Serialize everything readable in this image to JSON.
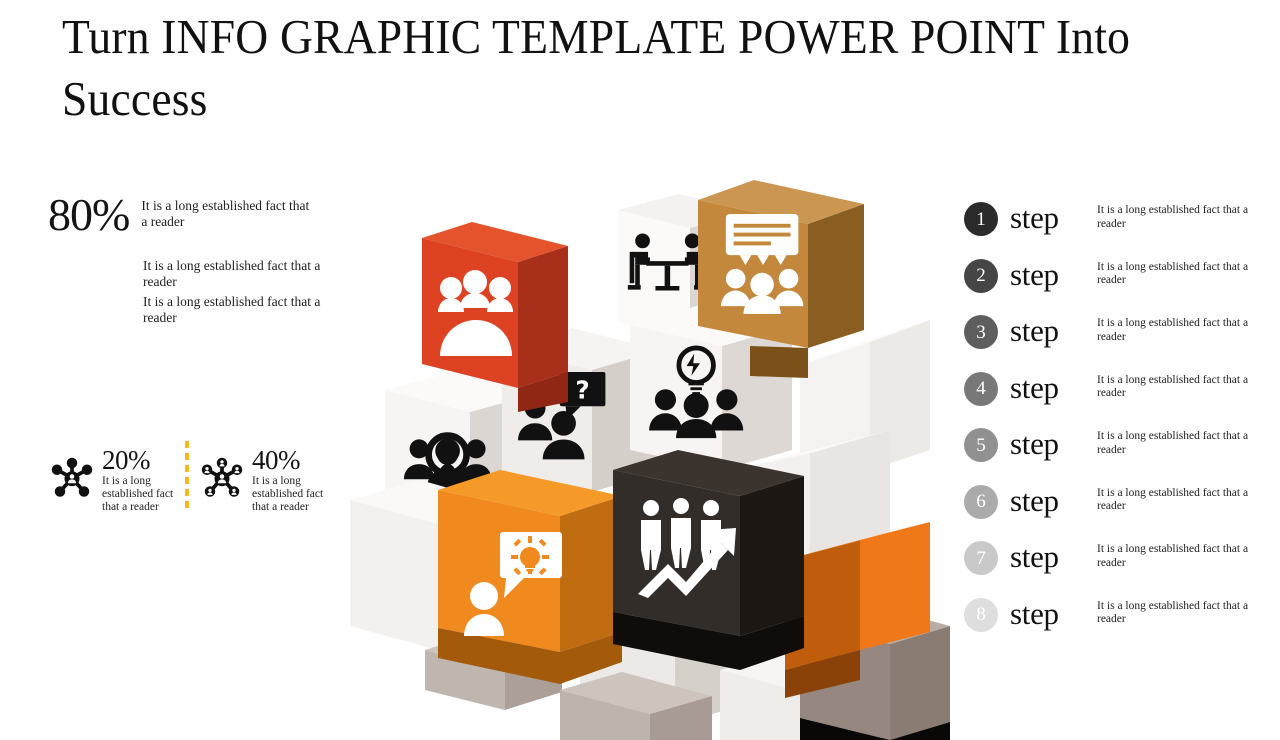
{
  "slide": {
    "title": "Turn INFO GRAPHIC TEMPLATE POWER POINT Into Success",
    "background_color": "#ffffff"
  },
  "left_panel": {
    "headline_stat": {
      "value": "80%",
      "description": "It is a long established fact that a reader"
    },
    "paragraphs": [
      "It is a long established fact that a reader",
      "It is a long established fact that a reader"
    ],
    "divider_color": "#f5b719",
    "metrics": [
      {
        "value": "20%",
        "description": "It is a long established fact that a reader",
        "icon": "network-hub-icon"
      },
      {
        "value": "40%",
        "description": "It is a long established fact that a reader",
        "icon": "network-hub-outline-icon"
      }
    ]
  },
  "steps": {
    "items": [
      {
        "number": "1",
        "label": "step",
        "description": "It is a long established fact that a reader",
        "badge_color": "#2b2b2b"
      },
      {
        "number": "2",
        "label": "step",
        "description": "It is a long established fact that a reader",
        "badge_color": "#454545"
      },
      {
        "number": "3",
        "label": "step",
        "description": "It is a long established fact that a reader",
        "badge_color": "#5e5e5e"
      },
      {
        "number": "4",
        "label": "step",
        "description": "It is a long established fact that a reader",
        "badge_color": "#787878"
      },
      {
        "number": "5",
        "label": "step",
        "description": "It is a long established fact that a reader",
        "badge_color": "#919191"
      },
      {
        "number": "6",
        "label": "step",
        "description": "It is a long established fact that a reader",
        "badge_color": "#ababab"
      },
      {
        "number": "7",
        "label": "step",
        "description": "It is a long established fact that a reader",
        "badge_color": "#c9c9c9"
      },
      {
        "number": "8",
        "label": "step",
        "description": "It is a long established fact that a reader",
        "badge_color": "#dedede"
      }
    ]
  },
  "cube_cluster": {
    "description": "3D isometric cluster of cubes with business icons",
    "cubes": [
      {
        "id": "cube-red",
        "icon": "group-of-people-icon",
        "top": "#e5532c",
        "left": "#dd4223",
        "right": "#a8301a",
        "icon_color": "#ffffff"
      },
      {
        "id": "cube-bronze",
        "icon": "presentation-audience-icon",
        "top": "#cb9652",
        "left": "#c4883c",
        "right": "#8a5d20",
        "icon_color": "#ffffff"
      },
      {
        "id": "cube-orange",
        "icon": "person-idea-bulb-icon",
        "top": "#f59a28",
        "left": "#f08a1e",
        "right": "#b4640c",
        "icon_color": "#ffffff"
      },
      {
        "id": "cube-dark",
        "icon": "team-growth-arrow-icon",
        "top": "#3a332e",
        "left": "#332d29",
        "right": "#1c1713",
        "icon_color": "#ffffff"
      },
      {
        "id": "cube-orange-2",
        "icon": "",
        "top": "#f07818",
        "left": "#f07818",
        "right": "#c05d0c",
        "icon_color": "#ffffff"
      },
      {
        "id": "cube-white-1",
        "icon": "meeting-table-icon",
        "top": "#f4f2f0",
        "left": "#eceae7",
        "right": "#d9d4d0",
        "icon_color": "#111111"
      },
      {
        "id": "cube-white-2",
        "icon": "people-search-icon",
        "top": "#f6f4f2",
        "left": "#efedea",
        "right": "#d6d1cc",
        "icon_color": "#111111"
      },
      {
        "id": "cube-white-3",
        "icon": "people-question-icon",
        "top": "#efece9",
        "left": "#e7e3df",
        "right": "#cdc7c1",
        "icon_color": "#111111"
      },
      {
        "id": "cube-white-4",
        "icon": "team-idea-bulb-icon",
        "top": "#f7f5f3",
        "left": "#f0eeec",
        "right": "#d8d3ce",
        "icon_color": "#111111"
      }
    ]
  }
}
